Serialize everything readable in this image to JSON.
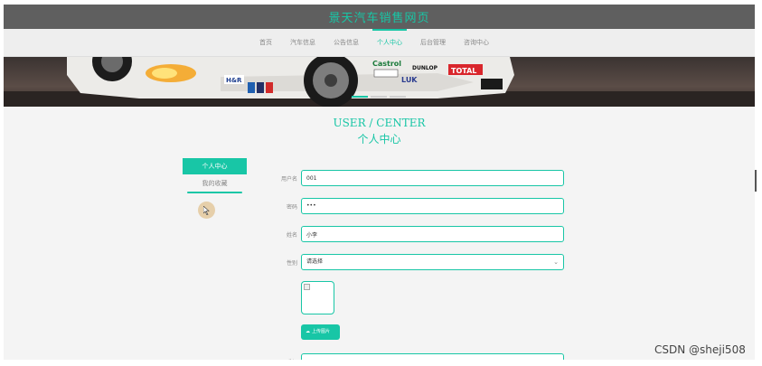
{
  "header": {
    "site_title": "景天汽车销售网页",
    "nav": [
      {
        "label": "首页",
        "active": false
      },
      {
        "label": "汽车信息",
        "active": false
      },
      {
        "label": "公告信息",
        "active": false
      },
      {
        "label": "个人中心",
        "active": true
      },
      {
        "label": "后台管理",
        "active": false
      },
      {
        "label": "咨询中心",
        "active": false
      }
    ]
  },
  "banner": {
    "sponsors": [
      "Castrol",
      "DUNLOP",
      "TOTAL",
      "LUK",
      "H&R"
    ]
  },
  "page": {
    "title_en": "USER / CENTER",
    "title_cn": "个人中心"
  },
  "side_menu": {
    "active_label": "个人中心",
    "favorites_label": "我的收藏"
  },
  "form": {
    "username_label": "用户名",
    "username_value": "001",
    "password_label": "密码",
    "password_value": "•••",
    "name_label": "姓名",
    "name_value": "小李",
    "gender_label": "性别",
    "gender_value": "请选择",
    "upload_label": "上传图片",
    "phone_label": "手机"
  },
  "watermark": "CSDN @sheji508",
  "colors": {
    "accent": "#18c6a6",
    "header_bg": "#5f5f5f",
    "nav_bg": "#eeeeee"
  }
}
